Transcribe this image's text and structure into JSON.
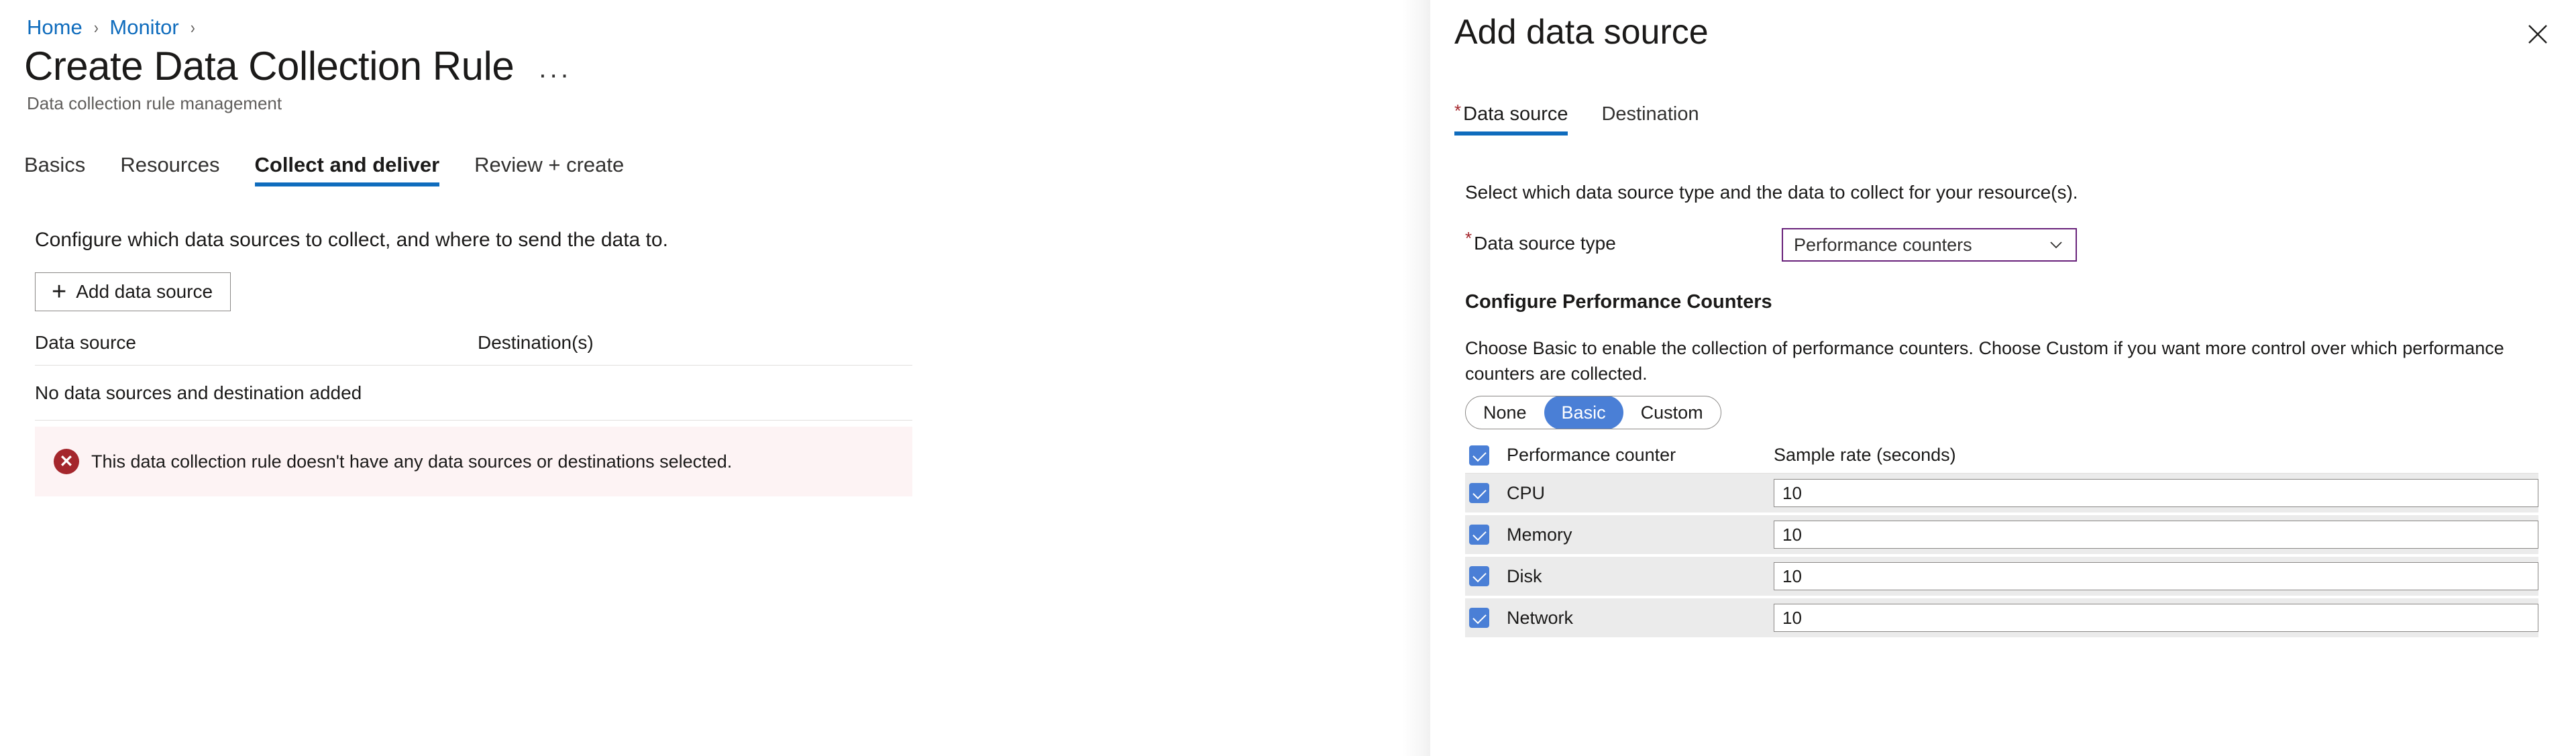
{
  "breadcrumb": {
    "items": [
      {
        "label": "Home"
      },
      {
        "label": "Monitor"
      }
    ],
    "separator": "›"
  },
  "page": {
    "title": "Create Data Collection Rule",
    "ellipsis": "···",
    "subtitle": "Data collection rule management"
  },
  "tabs": [
    {
      "label": "Basics",
      "active": false
    },
    {
      "label": "Resources",
      "active": false
    },
    {
      "label": "Collect and deliver",
      "active": true
    },
    {
      "label": "Review + create",
      "active": false
    }
  ],
  "collect": {
    "description": "Configure which data sources to collect, and where to send the data to.",
    "add_button": {
      "plus": "+",
      "label": "Add data source"
    },
    "table": {
      "columns": [
        "Data source",
        "Destination(s)"
      ],
      "empty_message": "No data sources and destination added",
      "rows": []
    },
    "error": {
      "icon": "error-circle-icon",
      "glyph": "✕",
      "message": "This data collection rule doesn't have any data sources or destinations selected.",
      "background": "#fdf3f4",
      "icon_color": "#a4262c"
    }
  },
  "pane": {
    "title": "Add data source",
    "close_label": "close-icon",
    "tabs": [
      {
        "label": "Data source",
        "required": true,
        "star": "*",
        "active": true
      },
      {
        "label": "Destination",
        "required": false,
        "star": "",
        "active": false
      }
    ],
    "description": "Select which data source type and the data to collect for your resource(s).",
    "data_source_type": {
      "star": "*",
      "label": "Data source type",
      "value": "Performance counters",
      "border_color": "#68217a",
      "options": [
        "Performance counters"
      ]
    },
    "configure": {
      "heading": "Configure Performance Counters",
      "description": "Choose Basic to enable the collection of performance counters. Choose Custom if you want more control over which performance counters are collected.",
      "mode_options": [
        {
          "label": "None",
          "selected": false
        },
        {
          "label": "Basic",
          "selected": true
        },
        {
          "label": "Custom",
          "selected": false
        }
      ],
      "selected_mode_color": "#4a7fd6"
    },
    "counters_table": {
      "columns": [
        "Performance counter",
        "Sample rate (seconds)"
      ],
      "header_checked": true,
      "rows": [
        {
          "name": "CPU",
          "checked": true,
          "sample_rate": "10"
        },
        {
          "name": "Memory",
          "checked": true,
          "sample_rate": "10"
        },
        {
          "name": "Disk",
          "checked": true,
          "sample_rate": "10"
        },
        {
          "name": "Network",
          "checked": true,
          "sample_rate": "10"
        }
      ]
    }
  },
  "theme": {
    "accent_blue": "#0f6cbd",
    "link_blue": "#0f6cbd",
    "azure_purple": "#68217a",
    "error_red": "#a4262c",
    "row_gray": "#ebebeb"
  }
}
